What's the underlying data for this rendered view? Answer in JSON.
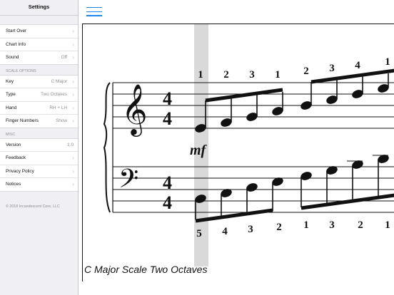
{
  "sidebar": {
    "title": "Settings",
    "group1": [
      {
        "label": "Start Over",
        "value": ""
      },
      {
        "label": "Chart Info",
        "value": ""
      },
      {
        "label": "Sound",
        "value": "Off"
      }
    ],
    "scale_options_header": "SCALE OPTIONS",
    "scale_options": [
      {
        "label": "Key",
        "value": "C Major"
      },
      {
        "label": "Type",
        "value": "Two Octaves"
      },
      {
        "label": "Hand",
        "value": "RH + LH"
      },
      {
        "label": "Finger Numbers",
        "value": "Show"
      }
    ],
    "misc_header": "MISC",
    "misc": [
      {
        "label": "Version",
        "value": "1.0"
      },
      {
        "label": "Feedback",
        "value": ""
      },
      {
        "label": "Privacy Policy",
        "value": ""
      },
      {
        "label": "Notices",
        "value": ""
      }
    ],
    "copyright": "© 2018 Incandescent Core, LLC"
  },
  "main": {
    "menu_icon": "hamburger-menu-icon",
    "accent_color": "#1c86f2",
    "caption": "C Major Scale Two Octaves",
    "time_signature": {
      "top": "4",
      "bottom": "4"
    },
    "dynamic": "mf",
    "treble_fingering": [
      "1",
      "2",
      "3",
      "1",
      "2",
      "3",
      "4",
      "1"
    ],
    "bass_fingering": [
      "5",
      "4",
      "3",
      "2",
      "1",
      "3",
      "2",
      "1"
    ]
  }
}
